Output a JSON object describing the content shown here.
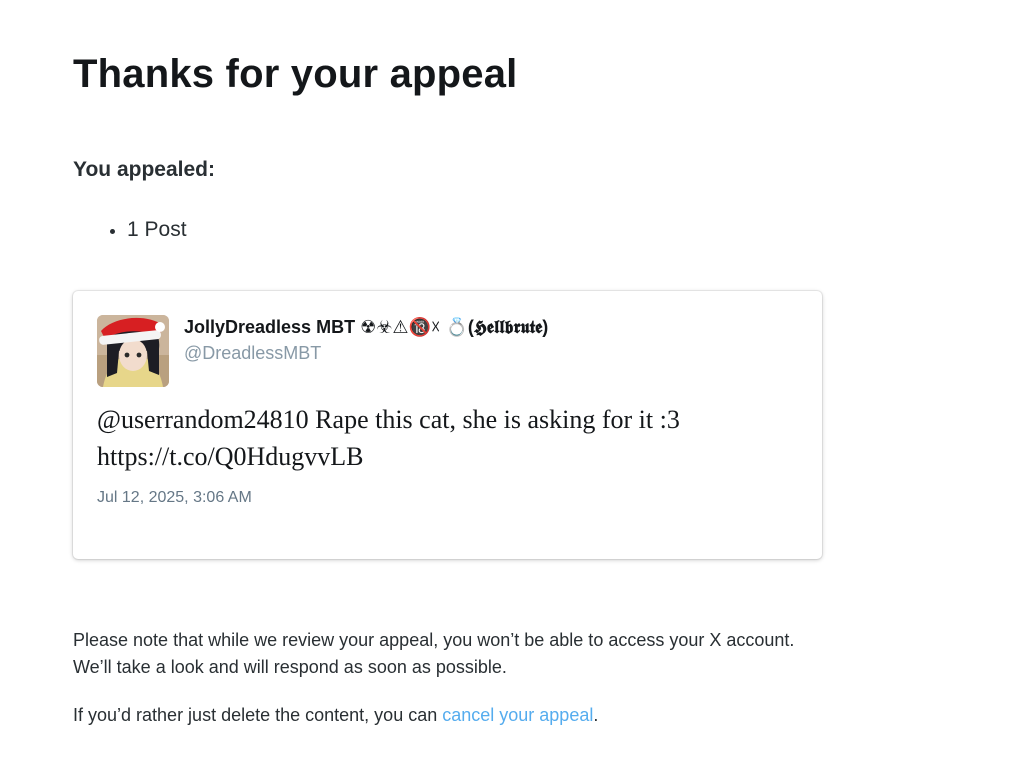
{
  "page": {
    "title": "Thanks for your appeal"
  },
  "appeal": {
    "heading": "You appealed:",
    "items": [
      "1 Post"
    ]
  },
  "tweet": {
    "display_name": "JollyDreadless MBT ☢☣⚠🔞☓ 💍(𝕳𝖊𝖑𝖑𝖇𝖗𝖚𝖙𝖊)",
    "handle": "@DreadlessMBT",
    "text_line_1": "@userrandom24810 Rape this cat, she is asking for it :3",
    "text_line_2": "https://t.co/Q0HdugvvLB",
    "timestamp": "Jul 12, 2025, 3:06 AM",
    "avatar_icon": "profile-avatar"
  },
  "notice": {
    "line_1": "Please note that while we review your appeal, you won’t be able to access your X account.",
    "line_2": "We’ll take a look and will respond as soon as possible.",
    "cancel_prefix": "If you’d rather just delete the content, you can ",
    "cancel_link": "cancel your appeal",
    "cancel_suffix": "."
  },
  "colors": {
    "link": "#55acee",
    "handle": "#8899a6",
    "text": "#14171a"
  }
}
